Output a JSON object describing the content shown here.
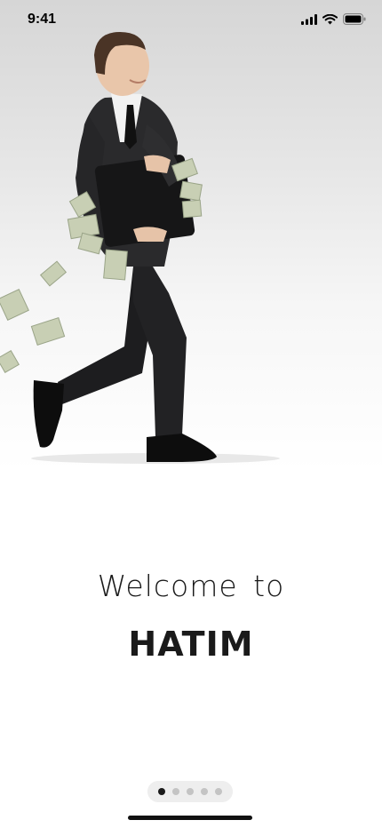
{
  "status_bar": {
    "time": "9:41",
    "icons": [
      "cellular-signal-icon",
      "wifi-icon",
      "battery-icon"
    ]
  },
  "hero": {
    "image_subject": "businessman-running-with-money-illustration"
  },
  "welcome": {
    "line1": "Welcome to",
    "brand": "HATIM"
  },
  "pager": {
    "count": 5,
    "active_index": 0
  },
  "colors": {
    "text": "#1a1a1a",
    "dot_inactive": "#c4c4c4",
    "dot_active": "#1a1a1a",
    "pager_bg": "#eeeeee"
  }
}
